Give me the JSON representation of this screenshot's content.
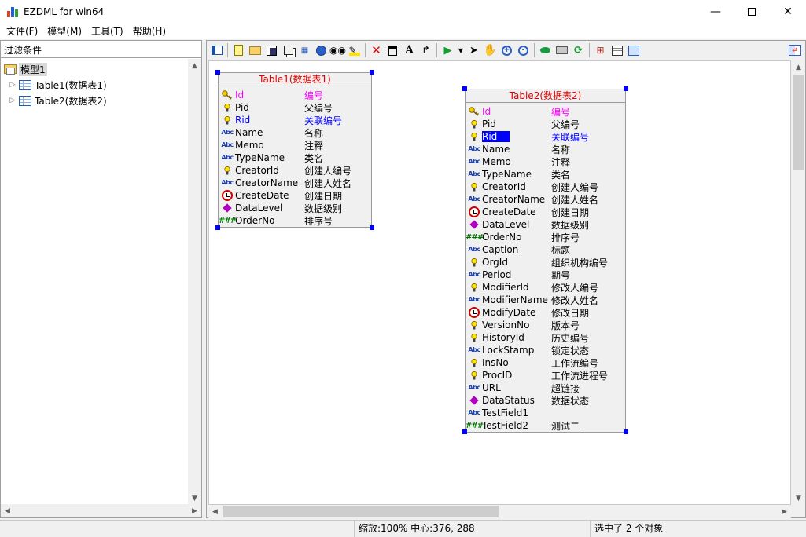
{
  "window": {
    "title": "EZDML for win64",
    "minimize_icon": "minimize-icon",
    "maximize_icon": "maximize-icon",
    "close_icon": "close-icon"
  },
  "menu": {
    "items": [
      {
        "label": "文件(F)"
      },
      {
        "label": "模型(M)"
      },
      {
        "label": "工具(T)"
      },
      {
        "label": "帮助(H)"
      }
    ]
  },
  "left_panel": {
    "filter_placeholder": "过滤条件",
    "tree": {
      "root": {
        "label": "模型1",
        "icon": "model-folder-icon"
      },
      "children": [
        {
          "label": "Table1(数据表1)",
          "icon": "table-icon"
        },
        {
          "label": "Table2(数据表2)",
          "icon": "table-icon"
        }
      ]
    }
  },
  "toolbar": {
    "buttons": [
      "toggle-panel-icon",
      "new-file-icon",
      "open-folder-icon",
      "save-icon",
      "copy-icon",
      "align-icon",
      "globe-icon",
      "find-icon",
      "highlight-icon",
      "delete-icon",
      "entity-icon",
      "text-icon",
      "link-icon",
      "run-icon",
      "dropdown-icon",
      "pointer-icon",
      "hand-icon",
      "zoom-in-icon",
      "zoom-out-icon",
      "view-icon",
      "print-icon",
      "refresh-icon",
      "import-icon",
      "properties-icon",
      "fit-icon"
    ],
    "right_button": "swap-icon"
  },
  "diagram": {
    "table1": {
      "title": "Table1(数据表1)",
      "fields": [
        {
          "name": "Id",
          "caption": "编号",
          "kind": "pk",
          "icon": "key-icon"
        },
        {
          "name": "Pid",
          "caption": "父编号",
          "kind": "normal",
          "icon": "bulb-icon"
        },
        {
          "name": "Rid",
          "caption": "关联编号",
          "kind": "fk",
          "icon": "bulb-icon"
        },
        {
          "name": "Name",
          "caption": "名称",
          "kind": "normal",
          "icon": "string-icon"
        },
        {
          "name": "Memo",
          "caption": "注释",
          "kind": "normal",
          "icon": "string-icon"
        },
        {
          "name": "TypeName",
          "caption": "类名",
          "kind": "normal",
          "icon": "string-icon"
        },
        {
          "name": "CreatorId",
          "caption": "创建人编号",
          "kind": "normal",
          "icon": "bulb-icon"
        },
        {
          "name": "CreatorName",
          "caption": "创建人姓名",
          "kind": "normal",
          "icon": "string-icon"
        },
        {
          "name": "CreateDate",
          "caption": "创建日期",
          "kind": "normal",
          "icon": "clock-icon"
        },
        {
          "name": "DataLevel",
          "caption": "数据级别",
          "kind": "normal",
          "icon": "diamond-icon"
        },
        {
          "name": "OrderNo",
          "caption": "排序号",
          "kind": "normal",
          "icon": "number-icon"
        }
      ]
    },
    "table2": {
      "title": "Table2(数据表2)",
      "fields": [
        {
          "name": "Id",
          "caption": "编号",
          "kind": "pk",
          "icon": "key-icon"
        },
        {
          "name": "Pid",
          "caption": "父编号",
          "kind": "normal",
          "icon": "bulb-icon"
        },
        {
          "name": "Rid",
          "caption": "关联编号",
          "kind": "fk-selected",
          "icon": "bulb-icon"
        },
        {
          "name": "Name",
          "caption": "名称",
          "kind": "normal",
          "icon": "string-icon"
        },
        {
          "name": "Memo",
          "caption": "注释",
          "kind": "normal",
          "icon": "string-icon"
        },
        {
          "name": "TypeName",
          "caption": "类名",
          "kind": "normal",
          "icon": "string-icon"
        },
        {
          "name": "CreatorId",
          "caption": "创建人编号",
          "kind": "normal",
          "icon": "bulb-icon"
        },
        {
          "name": "CreatorName",
          "caption": "创建人姓名",
          "kind": "normal",
          "icon": "string-icon"
        },
        {
          "name": "CreateDate",
          "caption": "创建日期",
          "kind": "normal",
          "icon": "clock-icon"
        },
        {
          "name": "DataLevel",
          "caption": "数据级别",
          "kind": "normal",
          "icon": "diamond-icon"
        },
        {
          "name": "OrderNo",
          "caption": "排序号",
          "kind": "normal",
          "icon": "number-icon"
        },
        {
          "name": "Caption",
          "caption": "标题",
          "kind": "normal",
          "icon": "string-icon"
        },
        {
          "name": "OrgId",
          "caption": "组织机构编号",
          "kind": "normal",
          "icon": "bulb-icon"
        },
        {
          "name": "Period",
          "caption": "期号",
          "kind": "normal",
          "icon": "string-icon"
        },
        {
          "name": "ModifierId",
          "caption": "修改人编号",
          "kind": "normal",
          "icon": "bulb-icon"
        },
        {
          "name": "ModifierName",
          "caption": "修改人姓名",
          "kind": "normal",
          "icon": "string-icon"
        },
        {
          "name": "ModifyDate",
          "caption": "修改日期",
          "kind": "normal",
          "icon": "clock-icon"
        },
        {
          "name": "VersionNo",
          "caption": "版本号",
          "kind": "normal",
          "icon": "bulb-icon"
        },
        {
          "name": "HistoryId",
          "caption": "历史编号",
          "kind": "normal",
          "icon": "bulb-icon"
        },
        {
          "name": "LockStamp",
          "caption": "锁定状态",
          "kind": "normal",
          "icon": "string-icon"
        },
        {
          "name": "InsNo",
          "caption": "工作流编号",
          "kind": "normal",
          "icon": "bulb-icon"
        },
        {
          "name": "ProcID",
          "caption": "工作流进程号",
          "kind": "normal",
          "icon": "bulb-icon"
        },
        {
          "name": "URL",
          "caption": "超链接",
          "kind": "normal",
          "icon": "string-icon"
        },
        {
          "name": "DataStatus",
          "caption": "数据状态",
          "kind": "normal",
          "icon": "diamond-icon"
        },
        {
          "name": "TestField1",
          "caption": "",
          "kind": "normal",
          "icon": "string-icon"
        },
        {
          "name": "TestField2",
          "caption": "测试二",
          "kind": "normal",
          "icon": "number-icon"
        }
      ]
    }
  },
  "status": {
    "zoom_center": "缩放:100% 中心:376, 288",
    "selection": "选中了 2 个对象"
  },
  "colors": {
    "pk": "#ff00ff",
    "fk": "#0000ff",
    "title": "#e00000",
    "selection": "#0000ff"
  }
}
